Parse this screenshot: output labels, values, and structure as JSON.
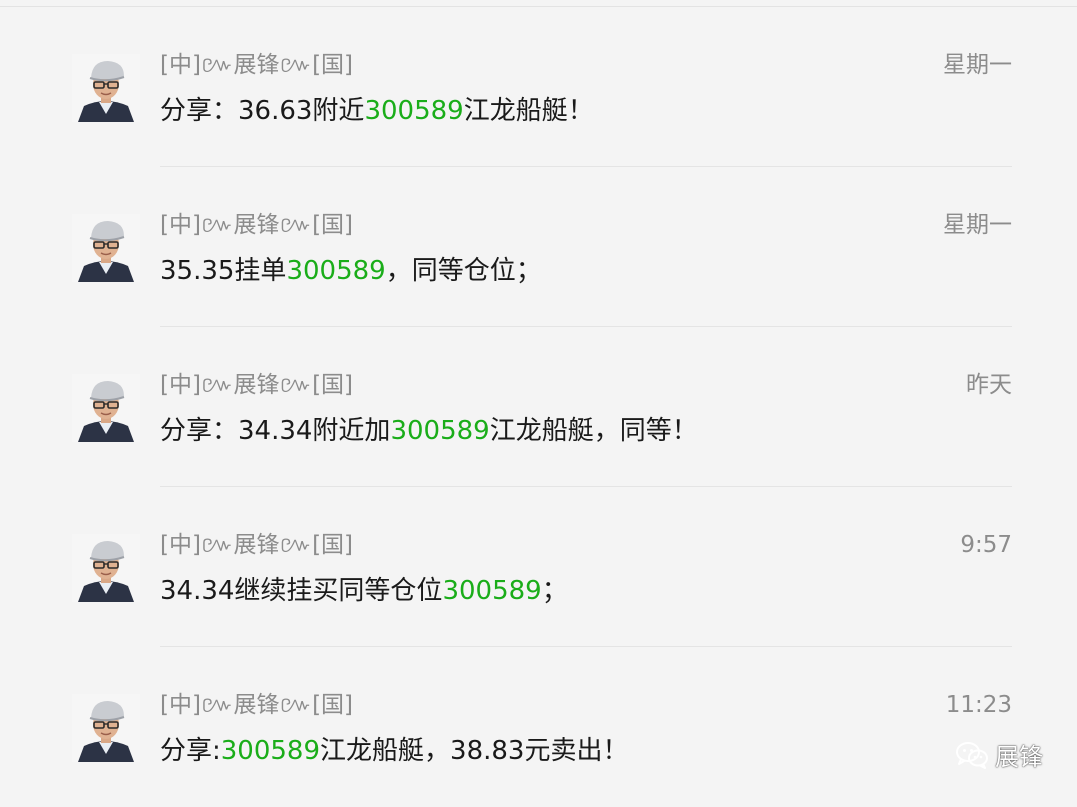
{
  "messages": [
    {
      "sender": "[中]៚展锋៚[国]",
      "time": "星期一",
      "parts": [
        {
          "text": "分享：36.63附近",
          "code": false
        },
        {
          "text": "300589",
          "code": true
        },
        {
          "text": "江龙船艇！",
          "code": false
        }
      ]
    },
    {
      "sender": "[中]៚展锋៚[国]",
      "time": "星期一",
      "parts": [
        {
          "text": "35.35挂单",
          "code": false
        },
        {
          "text": "300589",
          "code": true
        },
        {
          "text": "，同等仓位；",
          "code": false
        }
      ]
    },
    {
      "sender": "[中]៚展锋៚[国]",
      "time": "昨天",
      "parts": [
        {
          "text": "分享：34.34附近加",
          "code": false
        },
        {
          "text": "300589",
          "code": true
        },
        {
          "text": "江龙船艇，同等！",
          "code": false
        }
      ]
    },
    {
      "sender": "[中]៚展锋៚[国]",
      "time": "9:57",
      "parts": [
        {
          "text": "34.34继续挂买同等仓位",
          "code": false
        },
        {
          "text": "300589",
          "code": true
        },
        {
          "text": "；",
          "code": false
        }
      ]
    },
    {
      "sender": "[中]៚展锋៚[国]",
      "time": "11:23",
      "parts": [
        {
          "text": "分享:",
          "code": false
        },
        {
          "text": "300589",
          "code": true
        },
        {
          "text": "江龙船艇，38.83元卖出！",
          "code": false
        }
      ]
    }
  ],
  "watermark": {
    "icon": "wechat-icon",
    "label": "展锋"
  },
  "colors": {
    "background": "#f4f4f4",
    "stock_code": "#1aad19",
    "meta_text": "#8c8c8c",
    "body_text": "#1a1a1a"
  }
}
